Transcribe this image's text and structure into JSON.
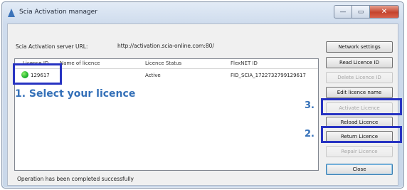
{
  "window": {
    "title": "Scia Activation manager",
    "minimize_glyph": "—",
    "maximize_glyph": "▭",
    "close_glyph": "✕"
  },
  "server": {
    "label": "Scia Activation server URL:",
    "url": "http://activation.scia-online.com:80/"
  },
  "table": {
    "columns": [
      "Licence ID",
      "Name of licence",
      "Licence Status",
      "FlexNET ID"
    ],
    "rows": [
      {
        "licence_id": "129617",
        "name": "",
        "status": "Active",
        "flexnet_id": "FID_SCIA_1722732799129617",
        "status_color": "#1eb32c"
      }
    ]
  },
  "buttons": {
    "network_settings": "Network settings",
    "read_licence_id": "Read Licence ID",
    "delete_licence_id": "Delete Licence ID",
    "edit_licence_name": "Edit licence name",
    "activate_licence": "Activate Licence",
    "reload_licence": "Reload Licence",
    "return_licence": "Return Licence",
    "repair_licence": "Repair Licence",
    "close": "Close"
  },
  "status_message": "Operation has been completed successfully",
  "annotations": {
    "step1": "1. Select your licence",
    "step2": "2.",
    "step3": "3.",
    "highlight_color": "#2733c2",
    "text_color": "#3470b8"
  }
}
